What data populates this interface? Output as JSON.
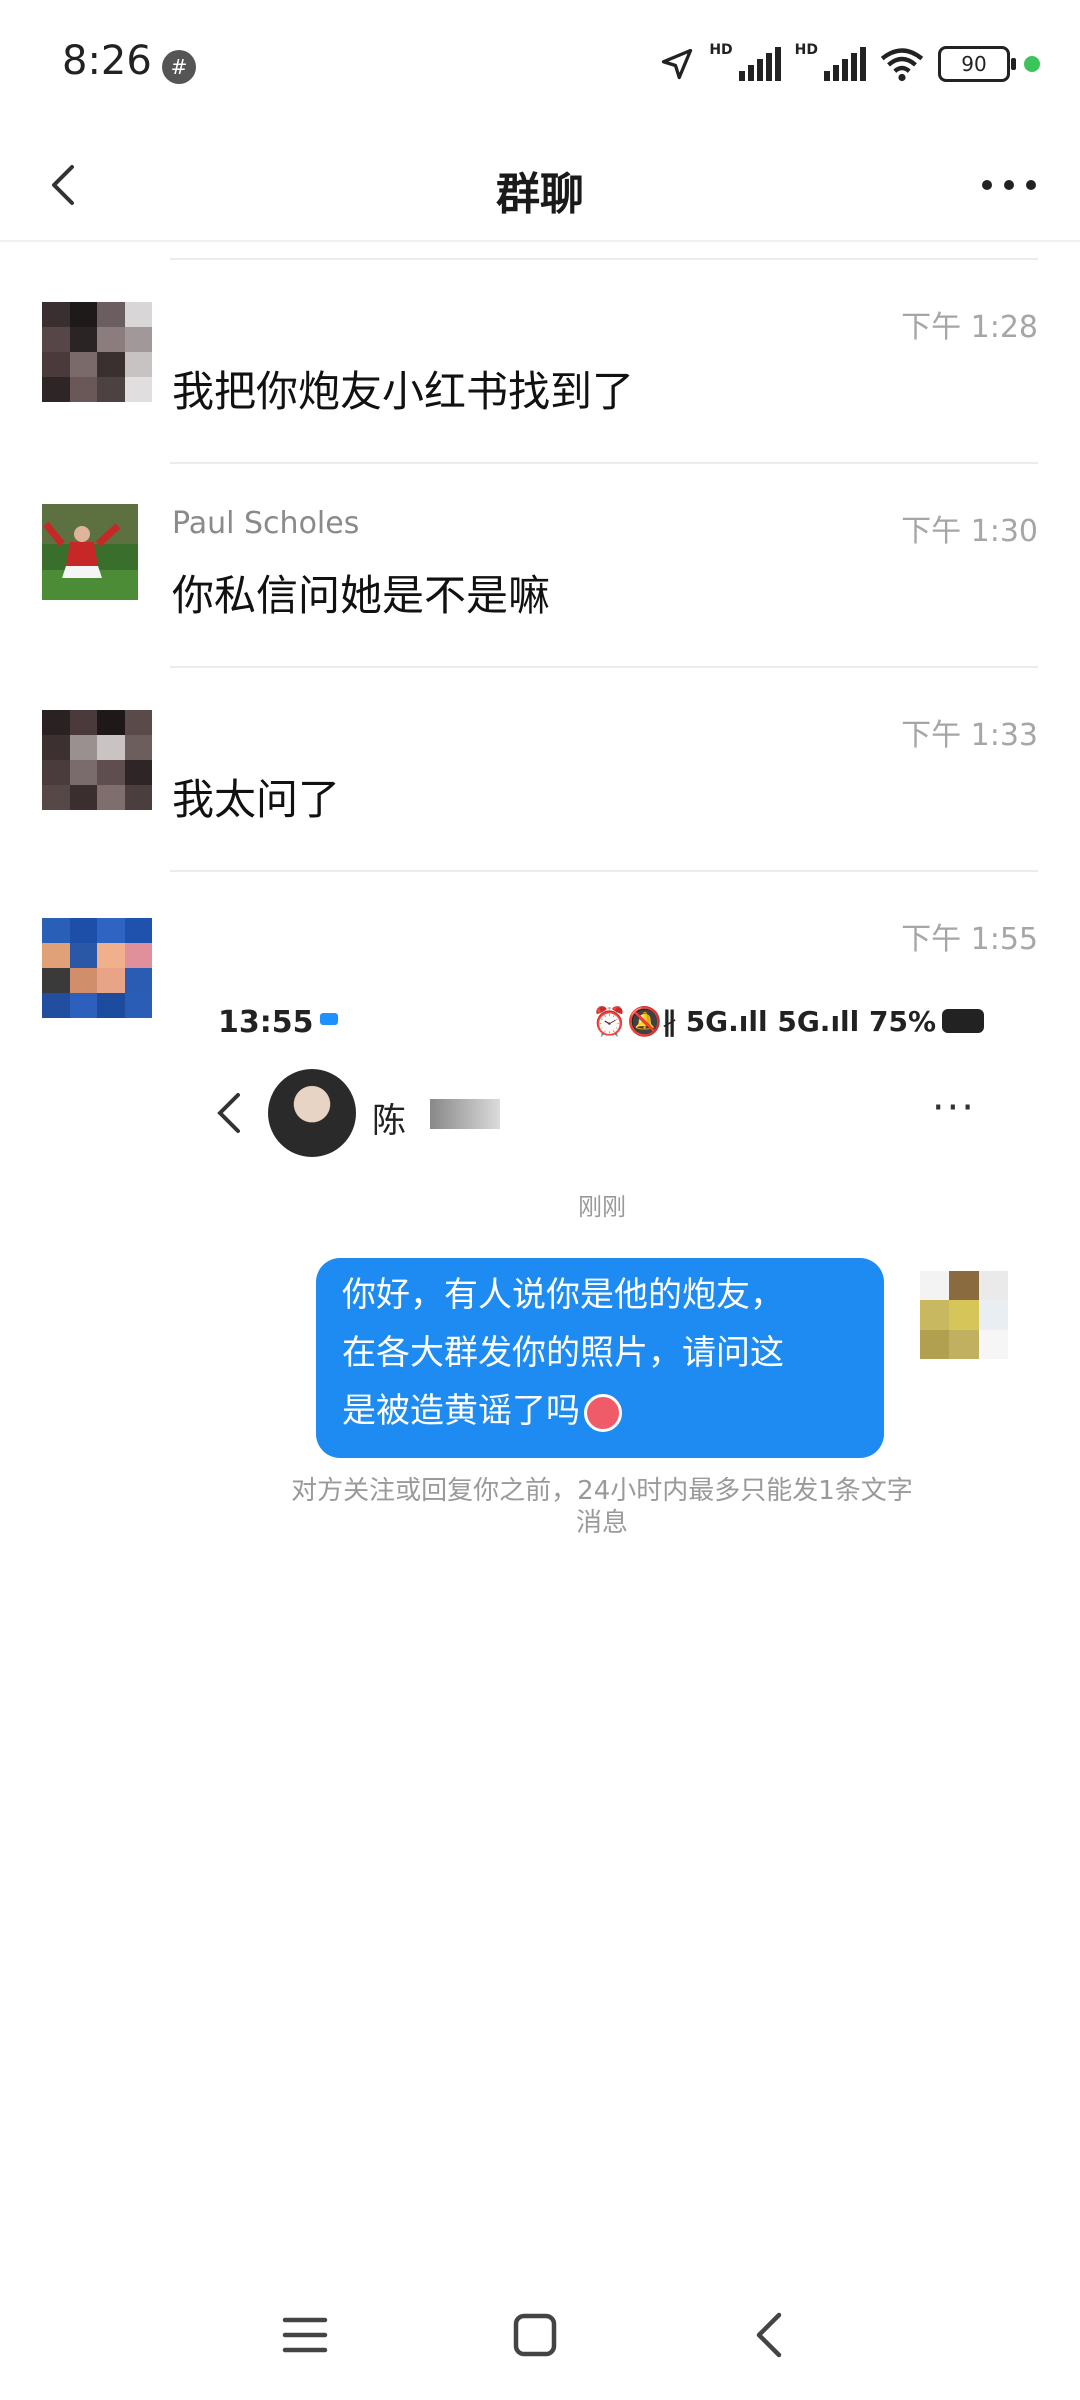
{
  "status_bar": {
    "time": "8:26",
    "hash_glyph": "#",
    "hd1": "HD",
    "hd2": "HD",
    "battery": "90"
  },
  "header": {
    "title": "群聊",
    "back_icon": "chevron-left-icon",
    "more_icon": "more-horizontal-icon"
  },
  "messages": [
    {
      "sender": "",
      "time": "下午 1:28",
      "text": "我把你炮友小红书找到了"
    },
    {
      "sender": "Paul Scholes",
      "time": "下午 1:30",
      "text": "你私信问她是不是嘛"
    },
    {
      "sender": "",
      "time": "下午 1:33",
      "text": "我太问了"
    },
    {
      "sender": "",
      "time": "下午 1:55",
      "text": ""
    }
  ],
  "screenshot": {
    "time": "13:55",
    "status_right": "⏰🔕∦ 5G.ıll 5G.ıll 75%",
    "contact_name": "陈",
    "more": "···",
    "timestamp": "刚刚",
    "bubble_lines": [
      "你好，有人说你是他的炮友，",
      "在各大群发你的照片，请问这",
      "是被造黄谣了吗"
    ],
    "note_lines": [
      "对方关注或回复你之前，24小时内最多只能发1条文字",
      "消息"
    ]
  },
  "nav": {
    "menu_icon": "menu-icon",
    "home_icon": "home-square-icon",
    "back_icon": "back-triangle-icon"
  },
  "colors": {
    "bubble": "#1e8bf3",
    "time_gray": "#a6a6a6",
    "online_dot": "#3bc45a"
  }
}
